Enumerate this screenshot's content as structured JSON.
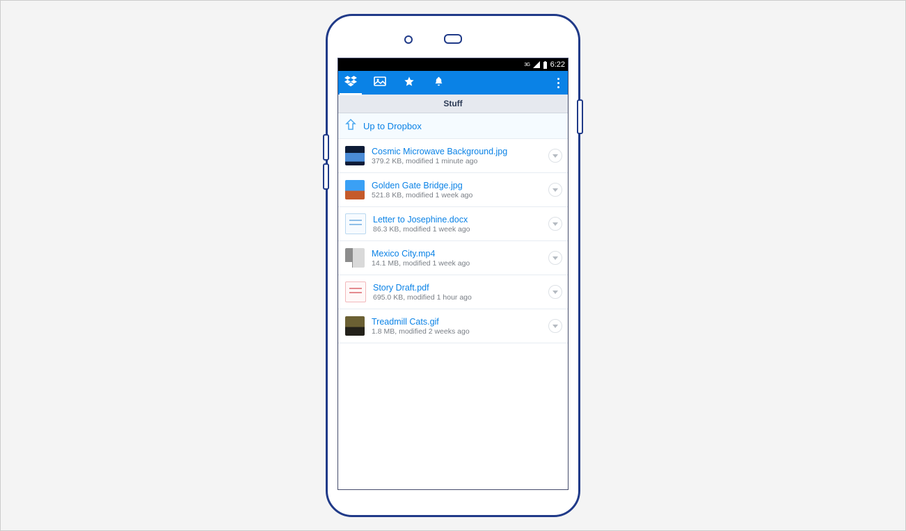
{
  "statusbar": {
    "network_label": "3G",
    "clock": "6:22"
  },
  "folder": {
    "title": "Stuff",
    "up_label": "Up to Dropbox"
  },
  "files": [
    {
      "name": "Cosmic Microwave Background.jpg",
      "meta": "379.2 KB, modified 1 minute ago",
      "thumb": "img1"
    },
    {
      "name": "Golden Gate Bridge.jpg",
      "meta": "521.8 KB, modified 1 week ago",
      "thumb": "img2"
    },
    {
      "name": "Letter to Josephine.docx",
      "meta": "86.3 KB, modified 1 week ago",
      "thumb": "doc"
    },
    {
      "name": "Mexico City.mp4",
      "meta": "14.1 MB, modified 1 week ago",
      "thumb": "img3"
    },
    {
      "name": "Story Draft.pdf",
      "meta": "695.0 KB, modified 1 hour ago",
      "thumb": "pdf"
    },
    {
      "name": "Treadmill Cats.gif",
      "meta": "1.8 MB, modified 2 weeks ago",
      "thumb": "img4"
    }
  ]
}
